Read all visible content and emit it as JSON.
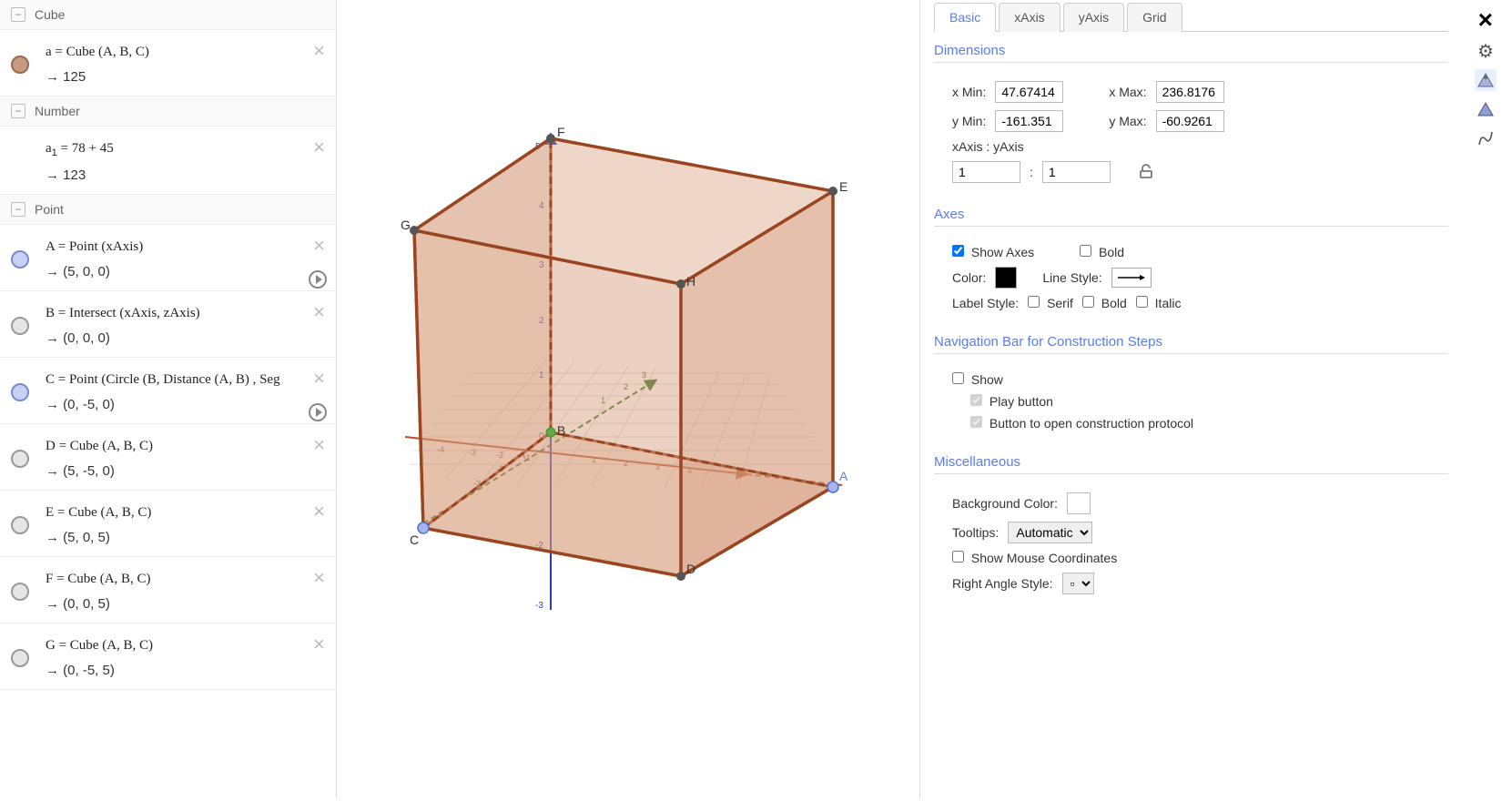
{
  "algebra": {
    "groups": [
      {
        "name": "Cube",
        "items": [
          {
            "dot": "brown",
            "def": "a = Cube (A, B, C)",
            "val": "→   125",
            "close": true
          }
        ]
      },
      {
        "name": "Number",
        "items": [
          {
            "dot": "none",
            "def": "a₁ = 78 + 45",
            "val": "→   123",
            "close": true
          }
        ]
      },
      {
        "name": "Point",
        "items": [
          {
            "dot": "blue",
            "def": "A = Point (xAxis)",
            "val": "→   (5,  0,  0)",
            "close": true,
            "play": true
          },
          {
            "dot": "gray",
            "def": "B = Intersect (xAxis, zAxis)",
            "val": "→   (0,  0,  0)",
            "close": true
          },
          {
            "dot": "blue",
            "def": "C = Point (Circle (B, Distance (A, B) , Seg",
            "val": "→   (0,  -5,  0)",
            "close": true,
            "play": true
          },
          {
            "dot": "gray",
            "def": "D = Cube (A, B, C)",
            "val": "→   (5,  -5,  0)",
            "close": true
          },
          {
            "dot": "gray",
            "def": "E = Cube (A, B, C)",
            "val": "→   (5,  0,  5)",
            "close": true
          },
          {
            "dot": "gray",
            "def": "F = Cube (A, B, C)",
            "val": "→   (0,  0,  5)",
            "close": true
          },
          {
            "dot": "gray",
            "def": "G = Cube (A, B, C)",
            "val": "→   (0,  -5,  5)",
            "close": true
          }
        ]
      }
    ]
  },
  "view3d": {
    "vertex_labels": [
      "A",
      "B",
      "C",
      "D",
      "E",
      "F",
      "G",
      "H"
    ],
    "xticks": [
      "-4",
      "-3",
      "-2",
      "-1",
      "1",
      "2",
      "3",
      "4"
    ],
    "yticks": [
      "-3",
      "-2",
      "-1",
      "1",
      "2",
      "3"
    ],
    "zticks": [
      "-3",
      "-2",
      "1",
      "2",
      "3",
      "4",
      "5"
    ]
  },
  "props": {
    "tabs": [
      "Basic",
      "xAxis",
      "yAxis",
      "Grid"
    ],
    "active_tab": 0,
    "dimensions": {
      "title": "Dimensions",
      "xmin_label": "x Min:",
      "xmin": "47.67414",
      "xmax_label": "x Max:",
      "xmax": "236.8176",
      "ymin_label": "y Min:",
      "ymin": "-161.351",
      "ymax_label": "y Max:",
      "ymax": "-60.9261",
      "ratio_label": "xAxis : yAxis",
      "ratio_x": "1",
      "ratio_y": "1"
    },
    "axes": {
      "title": "Axes",
      "show_axes": "Show Axes",
      "bold": "Bold",
      "color_label": "Color:",
      "line_style_label": "Line Style:",
      "label_style_label": "Label Style:",
      "serif": "Serif",
      "bold2": "Bold",
      "italic": "Italic"
    },
    "nav": {
      "title": "Navigation Bar for Construction Steps",
      "show": "Show",
      "play": "Play button",
      "proto": "Button to open construction protocol"
    },
    "misc": {
      "title": "Miscellaneous",
      "bg_label": "Background Color:",
      "tooltips_label": "Tooltips:",
      "tooltips_value": "Automatic",
      "show_mouse": "Show Mouse Coordinates",
      "ras_label": "Right Angle Style:",
      "ras_value": "▫"
    }
  }
}
